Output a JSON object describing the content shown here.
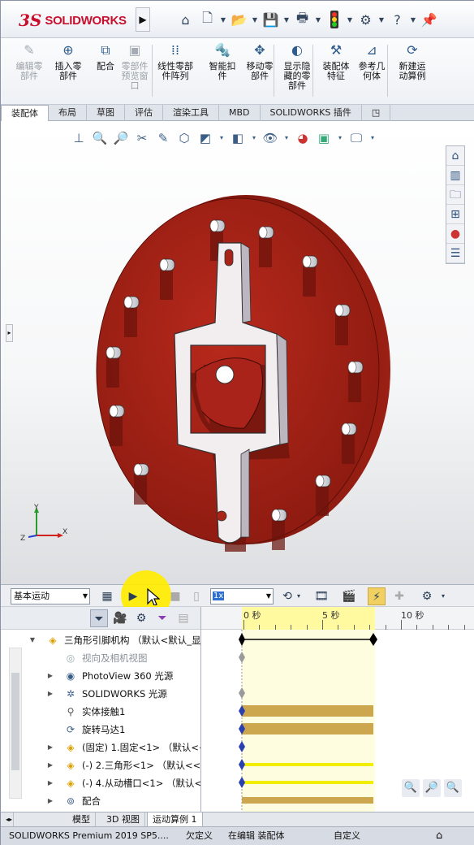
{
  "app": {
    "logo_ds": "3S",
    "logo_name": "SOLIDWORKS",
    "menu_arrow": "▶"
  },
  "quickbar": [
    "home-icon",
    "new-file-icon",
    "open-icon",
    "save-icon",
    "print-icon",
    "rebuild-traffic-light-icon",
    "options-gear-icon",
    "help-icon",
    "pin-icon"
  ],
  "ribbon": {
    "buttons": [
      {
        "label": "编辑零\n部件",
        "icon": "edit-part-icon",
        "enabled": false
      },
      {
        "label": "插入零\n部件",
        "icon": "insert-component-icon",
        "enabled": true
      },
      {
        "label": "配合",
        "icon": "mate-icon",
        "enabled": true
      },
      {
        "label": "零部件\n预览窗\n口",
        "icon": "component-preview-icon",
        "enabled": false
      },
      {
        "label": "线性零部\n件阵列",
        "icon": "linear-pattern-icon",
        "enabled": true
      },
      {
        "label": "智能扣\n件",
        "icon": "smart-fastener-icon",
        "enabled": true
      },
      {
        "label": "移动零\n部件",
        "icon": "move-component-icon",
        "enabled": true
      },
      {
        "label": "显示隐\n藏的零\n部件",
        "icon": "show-hidden-icon",
        "enabled": true
      },
      {
        "label": "装配体\n特征",
        "icon": "assembly-feature-icon",
        "enabled": true
      },
      {
        "label": "参考几\n何体",
        "icon": "reference-geometry-icon",
        "enabled": true
      },
      {
        "label": "新建运\n动算例",
        "icon": "new-motion-study-icon",
        "enabled": true
      }
    ]
  },
  "command_tabs": [
    "装配体",
    "布局",
    "草图",
    "评估",
    "渲染工具",
    "MBD",
    "SOLIDWORKS 插件"
  ],
  "command_tabs_active": 0,
  "motion_toolbar": {
    "study_type": "基本运动",
    "speed": "1x"
  },
  "timeline": {
    "ticks": [
      "0 秒",
      "5 秒",
      "10 秒"
    ]
  },
  "tree": {
    "root": "三角形引脚机构 （默认<默认_显",
    "items": [
      {
        "label": "视向及相机视图",
        "dim": true,
        "expand": "",
        "icon": "camera-view-icon"
      },
      {
        "label": "PhotoView 360 光源",
        "dim": false,
        "expand": "▶",
        "icon": "photoview-lights-icon"
      },
      {
        "label": "SOLIDWORKS 光源",
        "dim": false,
        "expand": "▶",
        "icon": "lights-icon"
      },
      {
        "label": "实体接触1",
        "dim": false,
        "expand": "",
        "icon": "contact-icon"
      },
      {
        "label": "旋转马达1",
        "dim": false,
        "expand": "",
        "icon": "rotary-motor-icon"
      },
      {
        "label": "(固定) 1.固定<1> （默认<<",
        "dim": false,
        "expand": "▶",
        "icon": "part-icon"
      },
      {
        "label": "(-) 2.三角形<1> （默认<<默",
        "dim": false,
        "expand": "▶",
        "icon": "part-icon"
      },
      {
        "label": "(-) 4.从动槽口<1> （默认<<",
        "dim": false,
        "expand": "▶",
        "icon": "part-icon"
      },
      {
        "label": "配合",
        "dim": false,
        "expand": "▶",
        "icon": "mates-icon"
      }
    ]
  },
  "bottom_tabs": [
    "模型",
    "3D 视图",
    "运动算例 1"
  ],
  "bottom_tabs_active": 2,
  "status": {
    "product": "SOLIDWORKS Premium 2019 SP5....",
    "definition": "欠定义",
    "editing": "在编辑 装配体",
    "units": "自定义"
  },
  "colors": {
    "disc": "#a82318",
    "slot_plate": "#f1eef0",
    "timeline_highlight": "#fffaa0",
    "key_bar": "#cda750",
    "cursor_highlight": "#ffec00"
  }
}
